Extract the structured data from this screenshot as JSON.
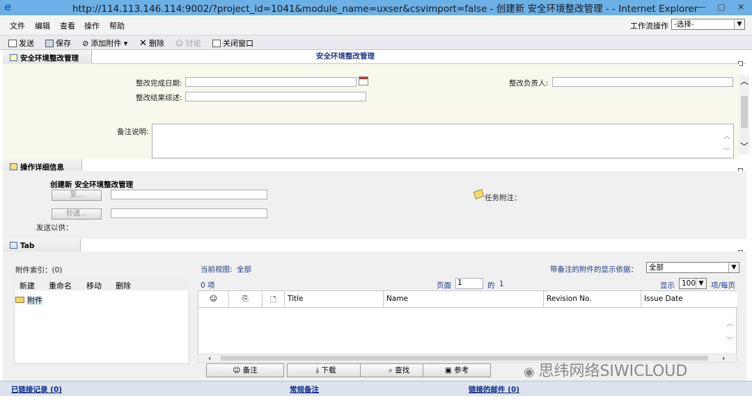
{
  "window": {
    "title": "http://114.113.146.114:9002/?project_id=1041&module_name=uxser&csvimport=false - 创建新 安全环境整改管理 - - Internet Explorer"
  },
  "menu": {
    "items": [
      "文件",
      "编辑",
      "查看",
      "操作",
      "帮助"
    ],
    "workflow_label": "工作流操作",
    "workflow_value": "-选择-"
  },
  "toolbar": {
    "send": "发送",
    "save": "保存",
    "attach": "添加附件",
    "delete": "删除",
    "discuss": "讨论",
    "close": "关闭窗口"
  },
  "section1": {
    "tab_label": "安全环境整改管理",
    "center_title": "安全环境整改管理",
    "fields": {
      "complete_date_label": "整改完成日期:",
      "complete_date_value": "",
      "result_label": "整改结果综述:",
      "result_value": "",
      "owner_label": "整改负责人:",
      "owner_value": "",
      "notes_label": "备注说明:",
      "notes_value": ""
    }
  },
  "section2": {
    "tab_label": "操作详细信息",
    "heading": "创建新 安全环境整改管理",
    "to_button": "至...",
    "cc_button": "抄送...",
    "send_for": "发送以供：",
    "task_note": "任务附注："
  },
  "tab_section": {
    "tab_label": "Tab",
    "attach_index": "附件索引：(0)",
    "tree_actions": [
      "新建",
      "重命名",
      "移动",
      "删除"
    ],
    "tree_root": "附件",
    "current_view_label": "当前视图:",
    "current_view_value": "全部",
    "display_basis_label": "带备注的附件的显示依据：",
    "display_basis_value": "全部",
    "item_count": "0 项",
    "page_label": "页面",
    "page_value": "1",
    "of_label": "的",
    "page_total": "1",
    "show_label": "显示",
    "per_page_value": "100",
    "per_page_suffix": "项/每页",
    "columns": [
      "Title",
      "Name",
      "Revision No.",
      "Issue Date"
    ],
    "buttons": [
      "备注",
      "下载",
      "查找",
      "参考"
    ]
  },
  "footer": {
    "links": [
      "已链接记录 (0)",
      "常规备注",
      "链接的邮件 (0)"
    ]
  },
  "watermark": "思纬网络SIWICLOUD"
}
